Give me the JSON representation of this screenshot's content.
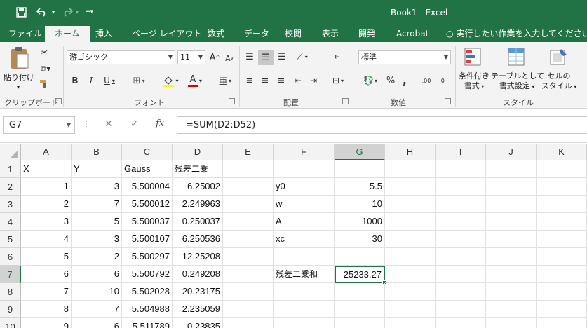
{
  "window": {
    "title": "Book1 - Excel",
    "quick_access": [
      "save-icon",
      "undo-icon",
      "redo-icon",
      "customize-icon"
    ]
  },
  "ribbon_tabs": [
    "ファイル",
    "ホーム",
    "挿入",
    "ページ レイアウト",
    "数式",
    "データ",
    "校閲",
    "表示",
    "開発",
    "Acrobat"
  ],
  "active_tab": "ホーム",
  "tell_me": "実行したい作業を入力してください...",
  "ribbon": {
    "clipboard": {
      "label": "クリップボード",
      "paste": "貼り付け"
    },
    "font": {
      "label": "フォント",
      "family": "游ゴシック",
      "size": "11",
      "bold": "B",
      "italic": "I",
      "underline": "U",
      "grow": "A",
      "shrink": "A",
      "phonetic": "亜"
    },
    "alignment": {
      "label": "配置"
    },
    "number": {
      "label": "数値",
      "format": "標準",
      "percent": "%",
      "comma": ","
    },
    "styles": {
      "label": "スタイル",
      "conditional": [
        "条件付き",
        "書式"
      ],
      "table": [
        "テーブルとして",
        "書式設定"
      ],
      "cell": [
        "セルの",
        "スタイル"
      ]
    }
  },
  "formula_bar": {
    "name_box": "G7",
    "formula": "=SUM(D2:D52)",
    "cancel": "✕",
    "enter": "✓",
    "fx": "fx"
  },
  "sheet": {
    "columns": [
      "A",
      "B",
      "C",
      "D",
      "E",
      "F",
      "G",
      "H",
      "I",
      "J",
      "K"
    ],
    "rows": [
      "1",
      "2",
      "3",
      "4",
      "5",
      "6",
      "7",
      "8",
      "9",
      "10"
    ],
    "active_cell": "G7",
    "cells": {
      "A1": "X",
      "B1": "Y",
      "C1": "Gauss",
      "D1": "残差二乗",
      "A2": "1",
      "B2": "3",
      "C2": "5.500004",
      "D2": "6.25002",
      "A3": "2",
      "B3": "7",
      "C3": "5.500012",
      "D3": "2.249963",
      "A4": "3",
      "B4": "5",
      "C4": "5.500037",
      "D4": "0.250037",
      "A5": "4",
      "B5": "3",
      "C5": "5.500107",
      "D5": "6.250536",
      "A6": "5",
      "B6": "2",
      "C6": "5.500297",
      "D6": "12.25208",
      "A7": "6",
      "B7": "6",
      "C7": "5.500792",
      "D7": "0.249208",
      "A8": "7",
      "B8": "10",
      "C8": "5.502028",
      "D8": "20.23175",
      "A9": "8",
      "B9": "7",
      "C9": "5.504988",
      "D9": "2.235059",
      "A10": "9",
      "B10": "6",
      "C10": "5.511789",
      "D10": "0.23835",
      "F2": "y0",
      "G2": "5.5",
      "F3": "w",
      "G3": "10",
      "F4": "A",
      "G4": "1000",
      "F5": "xc",
      "G5": "30",
      "F7": "残差二乗和",
      "G7": "25233.27"
    }
  },
  "colors": {
    "accent": "#217346",
    "ribbon_bg": "#f3f3f3",
    "header_bg": "#f3f3f3",
    "grid_line": "#e1e1e1"
  }
}
